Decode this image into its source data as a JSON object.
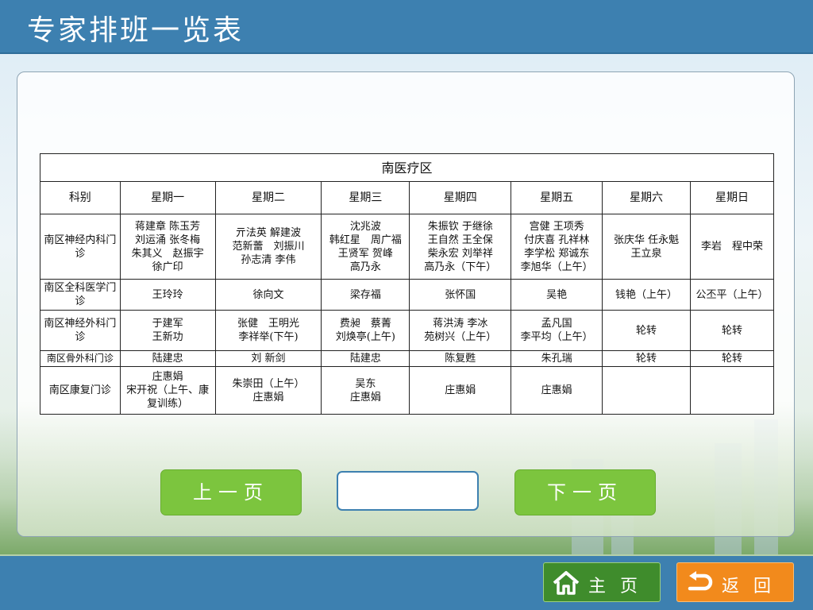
{
  "header": {
    "title": "专家排班一览表"
  },
  "table": {
    "zone": "南医疗区",
    "columns": [
      "科别",
      "星期一",
      "星期二",
      "星期三",
      "星期四",
      "星期五",
      "星期六",
      "星期日"
    ],
    "rows": [
      {
        "dept": "南区神经内科门诊",
        "days": [
          [
            "蒋建章 陈玉芳",
            "刘运涌 张冬梅",
            "朱其义　赵振宇",
            "徐广印"
          ],
          [
            "亓法英 解建波",
            "范新蕾　刘振川",
            "孙志清 李伟"
          ],
          [
            "沈兆波",
            "韩红星　周广福",
            "王贤军 贺峰",
            "高乃永"
          ],
          [
            "朱振钦 于继徐",
            "王自然 王全保",
            "柴永宏 刘举祥",
            "高乃永（下午）"
          ],
          [
            "宫健 王项秀",
            "付庆喜 孔祥林",
            "李学松 郑诚东",
            "李旭华（上午）"
          ],
          [
            "张庆华 任永魁",
            "王立泉"
          ],
          [
            "李岩　程中荣"
          ]
        ]
      },
      {
        "dept": "南区全科医学门诊",
        "days": [
          [
            "王玲玲"
          ],
          [
            "徐向文"
          ],
          [
            "梁存福"
          ],
          [
            "张怀国"
          ],
          [
            "吴艳"
          ],
          [
            "钱艳（上午）"
          ],
          [
            "公丕平（上午）"
          ]
        ]
      },
      {
        "dept": "南区神经外科门诊",
        "days": [
          [
            "于建军",
            "王新功"
          ],
          [
            "张健　王明光",
            "李祥举(下午)"
          ],
          [
            "费昶　蔡菁",
            "刘焕亭(上午)"
          ],
          [
            "蒋洪涛 李冰",
            "苑树兴（上午）"
          ],
          [
            "孟凡国",
            "李平均（上午）"
          ],
          [
            "轮转"
          ],
          [
            "轮转"
          ]
        ]
      },
      {
        "dept": "南区骨外科门诊",
        "days": [
          [
            "陆建忠"
          ],
          [
            "刘 新剑"
          ],
          [
            "陆建忠"
          ],
          [
            "陈复甦"
          ],
          [
            "朱孔瑞"
          ],
          [
            "轮转"
          ],
          [
            "轮转"
          ]
        ]
      },
      {
        "dept": "南区康复门诊",
        "days": [
          [
            "庄惠娟",
            "宋开祝（上午、康",
            "复训练）"
          ],
          [
            "朱崇田（上午）",
            "庄惠娟"
          ],
          [
            "吴东",
            "庄惠娟"
          ],
          [
            "庄惠娟"
          ],
          [
            "庄惠娟"
          ],
          [],
          []
        ]
      }
    ]
  },
  "pager": {
    "prev_label": "上一页",
    "next_label": "下一页",
    "page_value": ""
  },
  "footer": {
    "home_label": "主页",
    "back_label": "返回"
  },
  "icons": {
    "home": "house-icon",
    "back": "return-arrow-icon"
  },
  "colors": {
    "header_bg": "#3d80b0",
    "pager_button": "#7cc53e",
    "home_button": "#3f8c2c",
    "back_button": "#f28a1c"
  }
}
